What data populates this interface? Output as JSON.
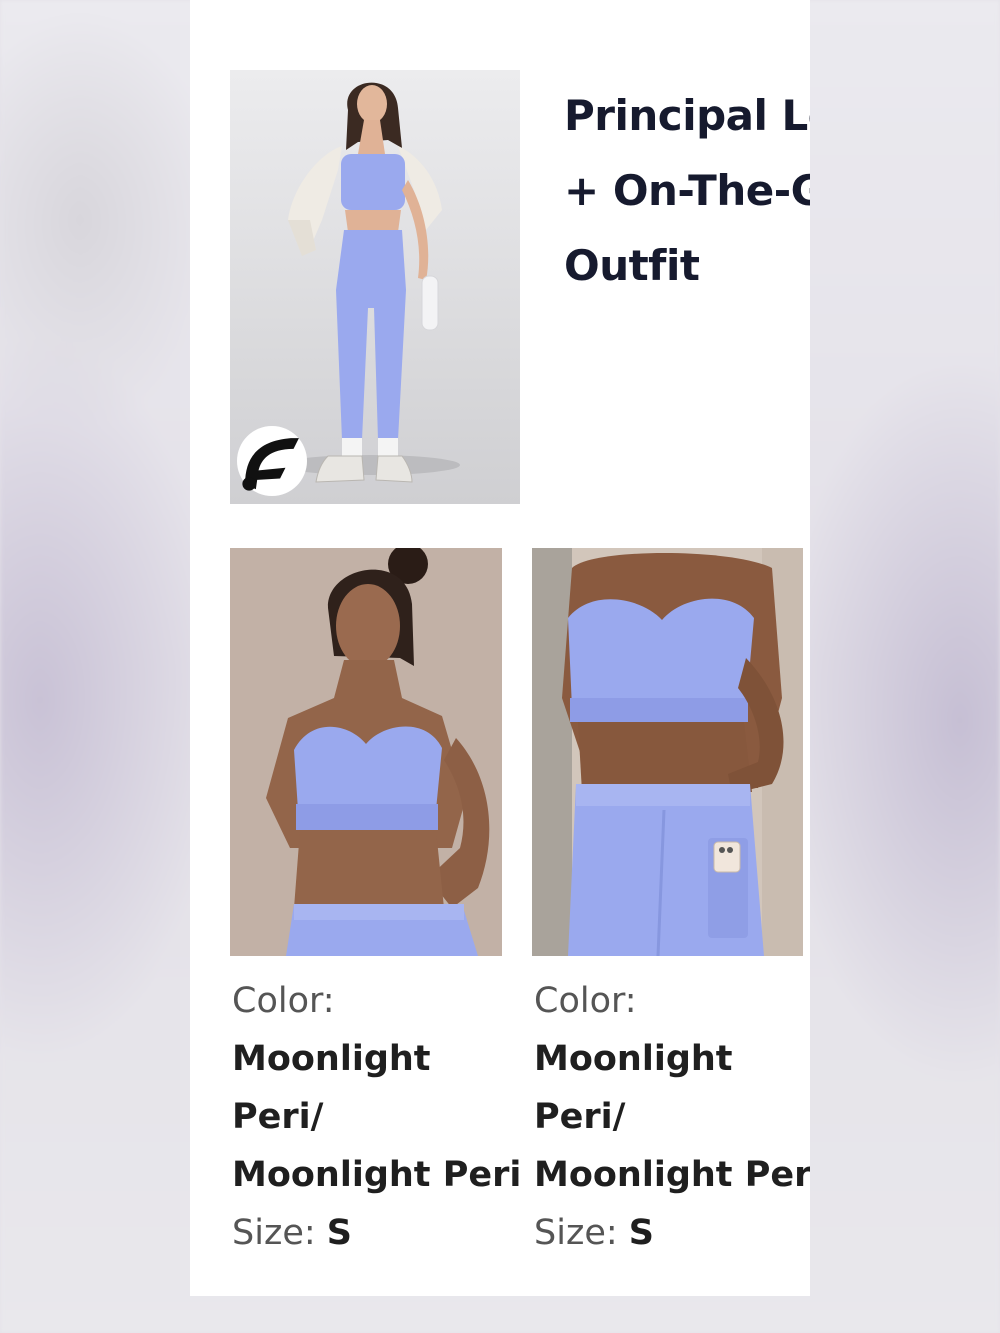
{
  "product": {
    "title_lines": [
      "Principal Lo",
      "+ On-The-Go",
      "Outfit"
    ],
    "hero_image": "model-in-moonlight-peri-outfit",
    "brand_icon": "fabletics-f-logo-icon"
  },
  "items": [
    {
      "image": "sports-bra-closeup-photo",
      "color_label": "Color:",
      "color_value": "Moonlight\nPeri/\nMoonlight Peri",
      "size_label": "Size: ",
      "size_value": "S"
    },
    {
      "image": "leggings-with-phone-pocket-photo",
      "color_label": "Color:",
      "color_value": "Moonlight\nPeri/\nMoonlight Peri",
      "size_label": "Size: ",
      "size_value": "S"
    }
  ],
  "colors": {
    "title": "#161a2e",
    "fabric": "#9aa9ee"
  }
}
